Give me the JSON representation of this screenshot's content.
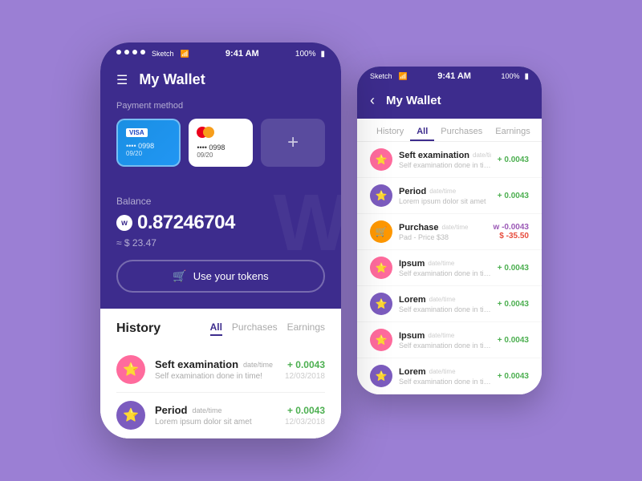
{
  "background": "#9b7fd4",
  "status_bar": {
    "dots": 4,
    "network": "Sketch",
    "wifi": "wifi",
    "time": "9:41 AM",
    "battery": "100%"
  },
  "main_phone": {
    "header": {
      "menu_icon": "☰",
      "title": "My Wallet"
    },
    "payment": {
      "label": "Payment method",
      "cards": [
        {
          "type": "visa",
          "brand": "VISA",
          "number": "•••• 0998",
          "date": "09/20",
          "active": true
        },
        {
          "type": "mastercard",
          "brand": "MC",
          "number": "•••• 0998",
          "date": "09/20",
          "active": false
        },
        {
          "type": "add",
          "label": "+"
        }
      ]
    },
    "balance": {
      "label": "Balance",
      "w_symbol": "w",
      "amount": "0.87246704",
      "usd_approx": "≈ $ 23.47"
    },
    "use_tokens_button": "Use your tokens",
    "history": {
      "title": "History",
      "tabs": [
        "All",
        "Purchases",
        "Earnings"
      ],
      "active_tab": "All",
      "items": [
        {
          "icon": "⭐",
          "icon_bg": "pink",
          "name": "Seft examination",
          "tag": "date/time",
          "desc": "Self examination done in time!",
          "amount": "+ 0.0043",
          "date": "12/03/2018",
          "positive": true
        },
        {
          "icon": "⭐",
          "icon_bg": "purple",
          "name": "Period",
          "tag": "date/time",
          "desc": "Lorem ipsum dolor sit amet",
          "amount": "+ 0.0043",
          "date": "12/03/2018",
          "positive": true
        }
      ]
    }
  },
  "secondary_phone": {
    "header": {
      "back": "‹",
      "title": "My Wallet"
    },
    "tabs": [
      "History",
      "All",
      "Purchases",
      "Earnings"
    ],
    "active_tab": "All",
    "items": [
      {
        "icon": "⭐",
        "icon_bg": "pink",
        "name": "Seft examination",
        "tag": "date/time",
        "desc": "Self examination done in time!",
        "amount": "+ 0.0043",
        "date": "",
        "positive": true,
        "type": "pos"
      },
      {
        "icon": "⭐",
        "icon_bg": "purple",
        "name": "Period",
        "tag": "date/time",
        "desc": "Lorem ipsum dolor sit amet",
        "amount": "+ 0.0043",
        "date": "",
        "positive": true,
        "type": "pos"
      },
      {
        "icon": "🛒",
        "icon_bg": "orange",
        "name": "Purchase",
        "tag": "date/time",
        "desc": "Pad - Price $38",
        "amount_w": "w -0.0043",
        "amount_usd": "$ -35.50",
        "positive": false,
        "type": "neg"
      },
      {
        "icon": "⭐",
        "icon_bg": "pink",
        "name": "Ipsum",
        "tag": "date/time",
        "desc": "Self examination done in time!",
        "amount": "+ 0.0043",
        "date": "",
        "positive": true,
        "type": "pos"
      },
      {
        "icon": "⭐",
        "icon_bg": "purple",
        "name": "Lorem",
        "tag": "date/time",
        "desc": "Self examination done in time!",
        "amount": "+ 0.0043",
        "date": "",
        "positive": true,
        "type": "pos"
      },
      {
        "icon": "⭐",
        "icon_bg": "pink",
        "name": "Ipsum",
        "tag": "date/time",
        "desc": "Self examination done in time!",
        "amount": "+ 0.0043",
        "date": "",
        "positive": true,
        "type": "pos"
      },
      {
        "icon": "⭐",
        "icon_bg": "purple",
        "name": "Lorem",
        "tag": "date/time",
        "desc": "Self examination done in time!",
        "amount": "+ 0.0043",
        "date": "",
        "positive": true,
        "type": "pos"
      }
    ]
  }
}
